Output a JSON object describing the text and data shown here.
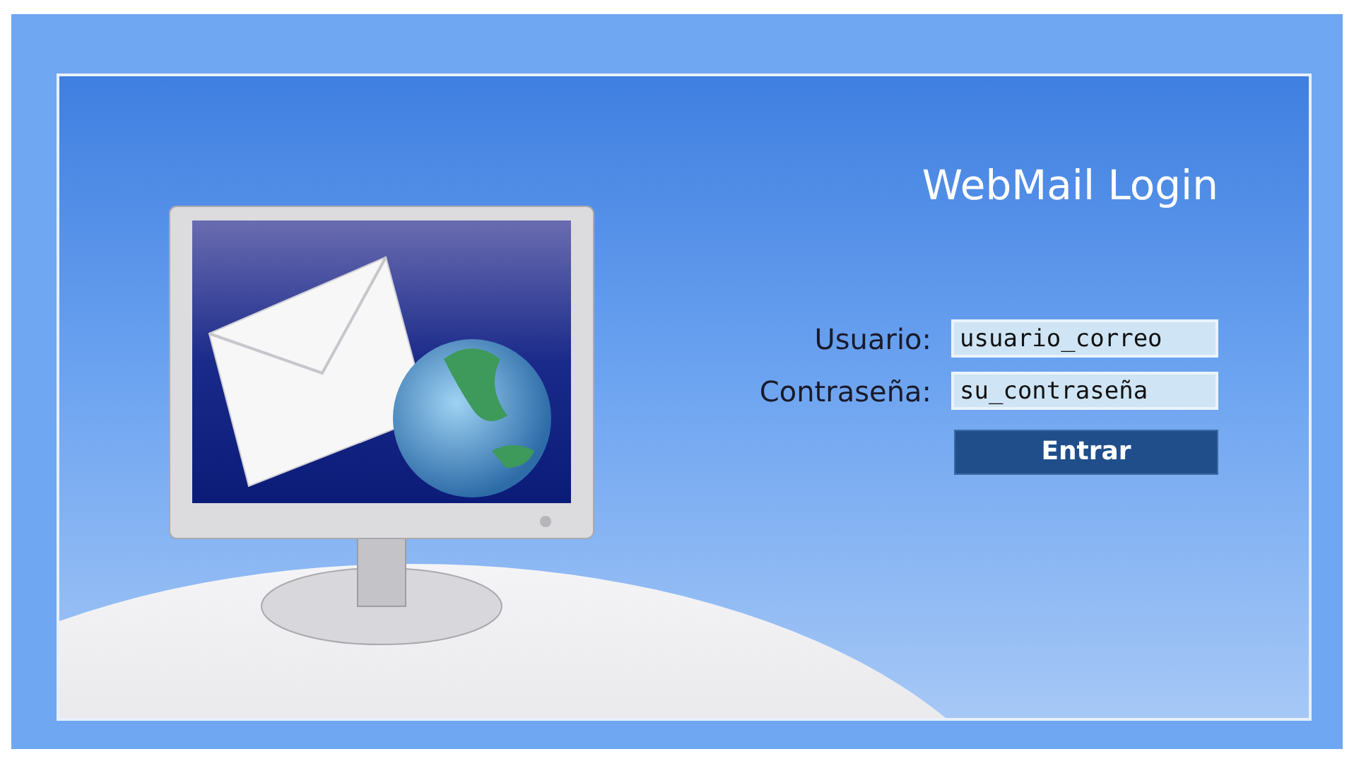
{
  "login": {
    "title": "WebMail Login",
    "fields": [
      {
        "label": "Usuario:",
        "value": "usuario_correo"
      },
      {
        "label": "Contraseña:",
        "value": "su_contraseña"
      }
    ],
    "button": "Entrar"
  }
}
